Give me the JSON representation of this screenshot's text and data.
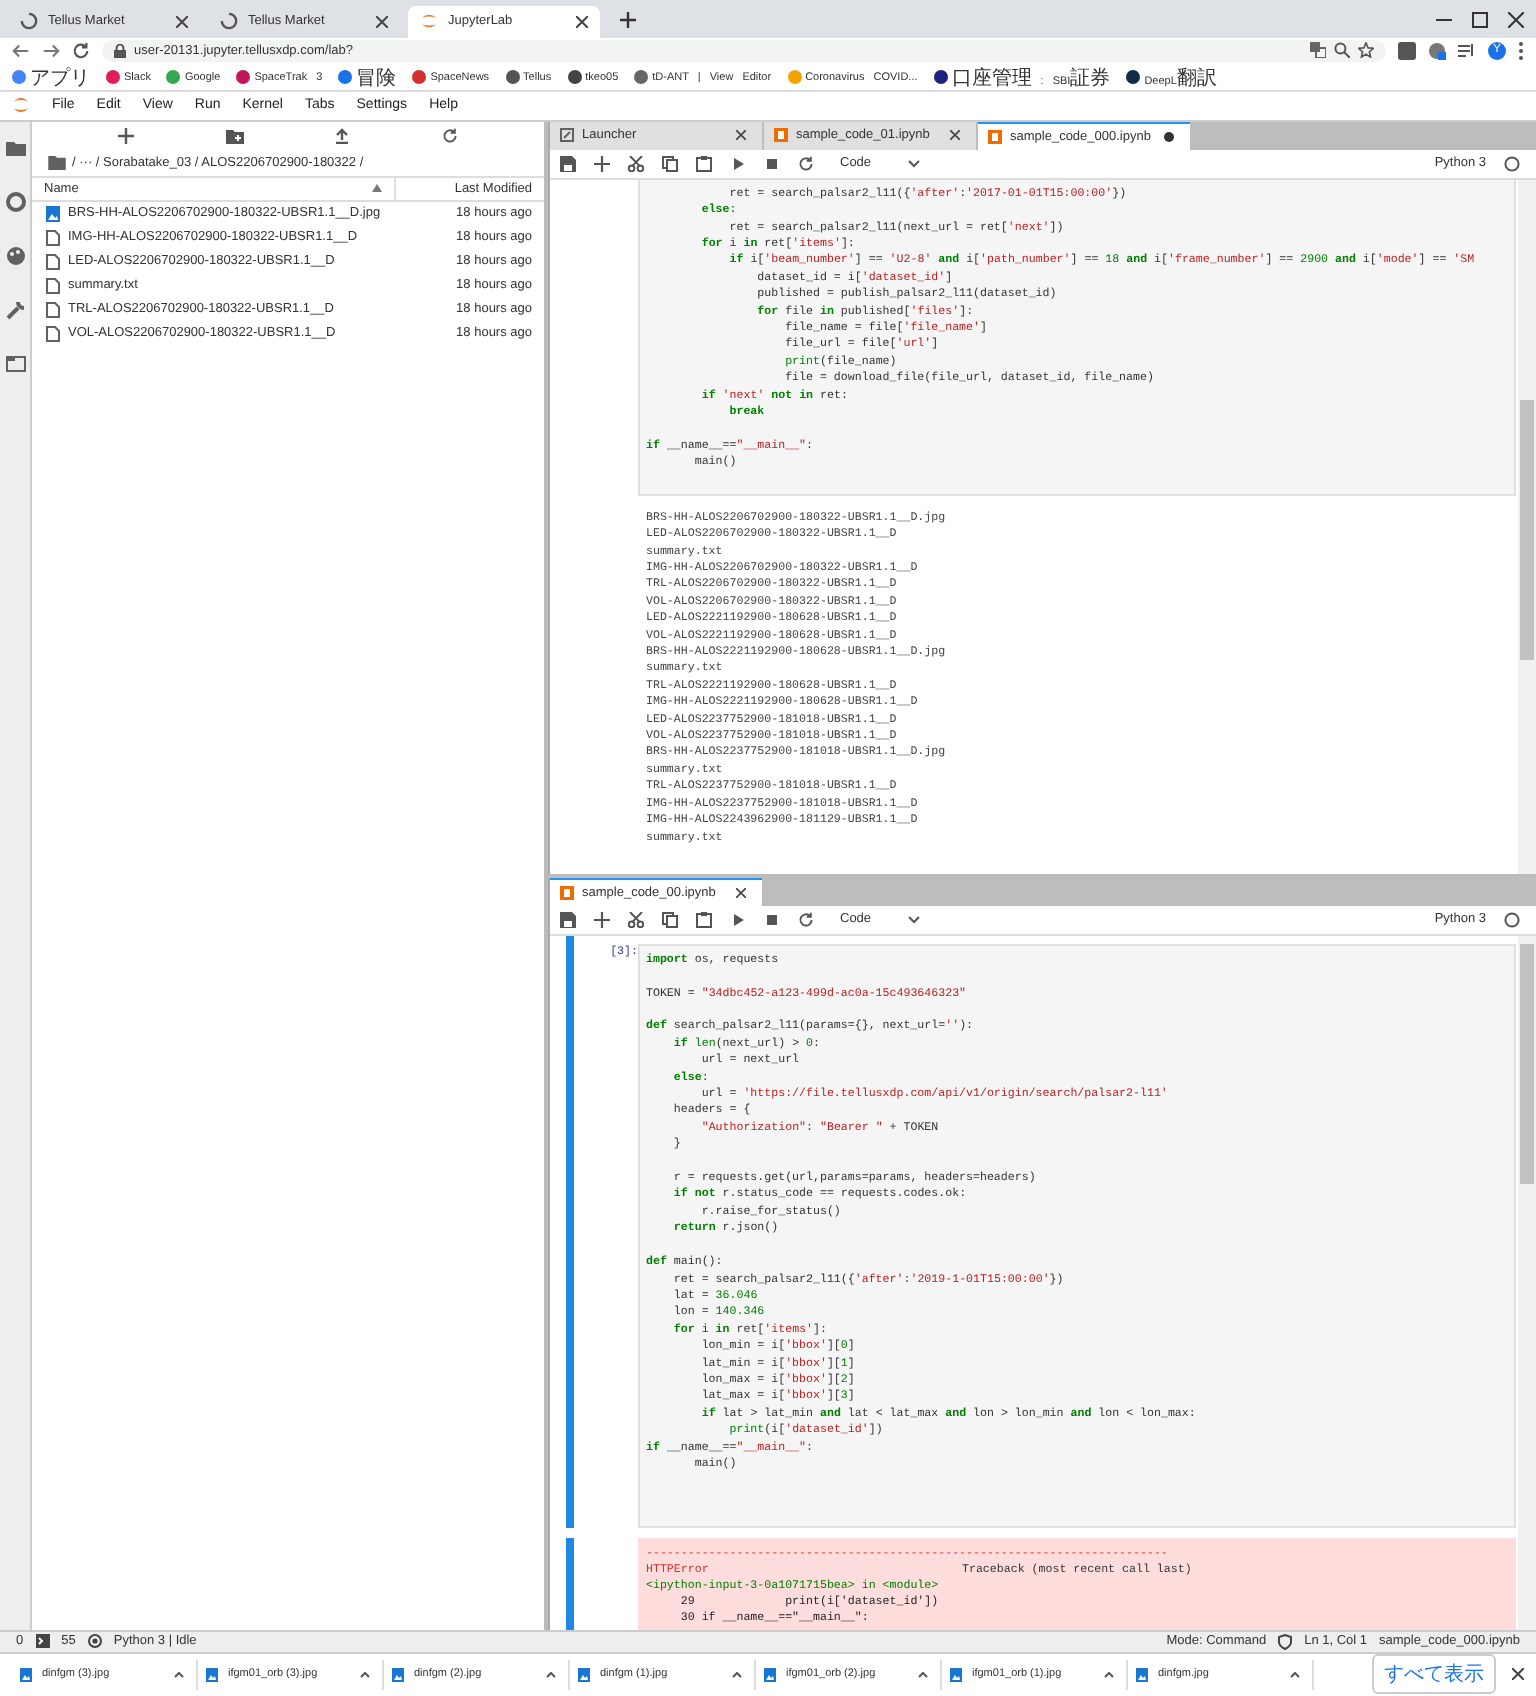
{
  "browser": {
    "tabs": [
      {
        "title": "Tellus Market",
        "kind": "loading",
        "selected": false
      },
      {
        "title": "Tellus Market",
        "kind": "loading",
        "selected": false
      },
      {
        "title": "JupyterLab",
        "kind": "jupyter",
        "selected": true
      }
    ],
    "url": "user-20131.jupyter.tellusxdp.com/lab?",
    "avatar_letter": "Y",
    "bookmarks": [
      {
        "label": "アプリ",
        "color": "#4285f4"
      },
      {
        "label": "Slack",
        "color": "#e01e5a"
      },
      {
        "label": "Google",
        "color": "#34a853"
      },
      {
        "label": "SpaceTrak 3",
        "color": "#c2185b"
      },
      {
        "label": "冒険",
        "color": "#1a73e8"
      },
      {
        "label": "SpaceNews",
        "color": "#d32f2f"
      },
      {
        "label": "Tellus",
        "color": "#555555"
      },
      {
        "label": "tkeo05",
        "color": "#444444"
      },
      {
        "label": "tD-ANT | View Editor",
        "color": "#666666"
      },
      {
        "label": "Coronavirus COVID...",
        "color": "#f4a300"
      },
      {
        "label": "口座管理 : SBI証券",
        "color": "#1a237e"
      },
      {
        "label": "DeepL翻訳",
        "color": "#0f2b46"
      }
    ]
  },
  "menu": [
    "File",
    "Edit",
    "View",
    "Run",
    "Kernel",
    "Tabs",
    "Settings",
    "Help"
  ],
  "file_browser": {
    "breadcrumb": "/ ··· / Sorabatake_03 / ALOS2206702900-180322 /",
    "columns": [
      "Name",
      "Last Modified"
    ],
    "files": [
      {
        "name": "BRS-HH-ALOS2206702900-180322-UBSR1.1__D.jpg",
        "modified": "18 hours ago",
        "kind": "image"
      },
      {
        "name": "IMG-HH-ALOS2206702900-180322-UBSR1.1__D",
        "modified": "18 hours ago",
        "kind": "file"
      },
      {
        "name": "LED-ALOS2206702900-180322-UBSR1.1__D",
        "modified": "18 hours ago",
        "kind": "file"
      },
      {
        "name": "summary.txt",
        "modified": "18 hours ago",
        "kind": "file"
      },
      {
        "name": "TRL-ALOS2206702900-180322-UBSR1.1__D",
        "modified": "18 hours ago",
        "kind": "file"
      },
      {
        "name": "VOL-ALOS2206702900-180322-UBSR1.1__D",
        "modified": "18 hours ago",
        "kind": "file"
      }
    ]
  },
  "panels": [
    {
      "tabs": [
        {
          "title": "Launcher",
          "kind": "launcher",
          "selected": false,
          "dirty": false
        },
        {
          "title": "sample_code_01.ipynb",
          "kind": "notebook",
          "selected": false,
          "dirty": false
        },
        {
          "title": "sample_code_000.ipynb",
          "kind": "notebook",
          "selected": true,
          "dirty": true
        }
      ],
      "cell_type": "Code",
      "kernel": "Python 3",
      "kernel_busy": false,
      "cell": {
        "active": false,
        "code": "            ret = search_palsar2_l11({'after':'2017-01-01T15:00:00'})\n        else:\n            ret = search_palsar2_l11(next_url = ret['next'])\n        for i in ret['items']:\n            if i['beam_number'] == 'U2-8' and i['path_number'] == 18 and i['frame_number'] == 2900 and i['mode'] == 'SM\n                dataset_id = i['dataset_id']\n                published = publish_palsar2_l11(dataset_id)\n                for file in published['files']:\n                    file_name = file['file_name']\n                    file_url = file['url']\n                    print(file_name)\n                    file = download_file(file_url, dataset_id, file_name)\n        if 'next' not in ret:\n            break\n\nif __name__==\"__main__\":\n       main()"
      },
      "output": "BRS-HH-ALOS2206702900-180322-UBSR1.1__D.jpg\nLED-ALOS2206702900-180322-UBSR1.1__D\nsummary.txt\nIMG-HH-ALOS2206702900-180322-UBSR1.1__D\nTRL-ALOS2206702900-180322-UBSR1.1__D\nVOL-ALOS2206702900-180322-UBSR1.1__D\nLED-ALOS2221192900-180628-UBSR1.1__D\nVOL-ALOS2221192900-180628-UBSR1.1__D\nBRS-HH-ALOS2221192900-180628-UBSR1.1__D.jpg\nsummary.txt\nTRL-ALOS2221192900-180628-UBSR1.1__D\nIMG-HH-ALOS2221192900-180628-UBSR1.1__D\nLED-ALOS2237752900-181018-UBSR1.1__D\nVOL-ALOS2237752900-181018-UBSR1.1__D\nBRS-HH-ALOS2237752900-181018-UBSR1.1__D.jpg\nsummary.txt\nTRL-ALOS2237752900-181018-UBSR1.1__D\nIMG-HH-ALOS2237752900-181018-UBSR1.1__D\nIMG-HH-ALOS2243962900-181129-UBSR1.1__D\nsummary.txt"
    },
    {
      "tabs": [
        {
          "title": "sample_code_00.ipynb",
          "kind": "notebook",
          "selected": true,
          "dirty": false
        }
      ],
      "cell_type": "Code",
      "kernel": "Python 3",
      "kernel_busy": false,
      "cell": {
        "prompt": "[3]:",
        "active": true,
        "code": "import os, requests\n\nTOKEN = \"34dbc452-a123-499d-ac0a-15c493646323\"\n\ndef search_palsar2_l11(params={}, next_url=''):\n    if len(next_url) > 0:\n        url = next_url\n    else:\n        url = 'https://file.tellusxdp.com/api/v1/origin/search/palsar2-l11'\n    headers = {\n        \"Authorization\": \"Bearer \" + TOKEN\n    }\n\n    r = requests.get(url,params=params, headers=headers)\n    if not r.status_code == requests.codes.ok:\n        r.raise_for_status()\n    return r.json()\n\ndef main():\n    ret = search_palsar2_l11({'after':'2019-1-01T15:00:00'})\n    lat = 36.046\n    lon = 140.346\n    for i in ret['items']:\n        lon_min = i['bbox'][0]\n        lat_min = i['bbox'][1]\n        lon_max = i['bbox'][2]\n        lat_max = i['bbox'][3]\n        if lat > lat_min and lat < lat_max and lon > lon_min and lon < lon_max:\n            print(i['dataset_id'])\nif __name__==\"__main__\":\n       main()"
      },
      "error": {
        "rule": "---------------------------------------------------------------------------",
        "name": "HTTPError",
        "traceback": "Traceback (most recent call last)",
        "location": "<ipython-input-3-0a1071715bea> in <module>",
        "lines": [
          "     29             print(i['dataset_id'])",
          "     30 if __name__==\"__main__\":"
        ]
      }
    }
  ],
  "status_bar": {
    "count": "0",
    "terminals": "55",
    "kernel": "Python 3 | Idle",
    "mode": "Mode: Command",
    "position": "Ln 1, Col 1",
    "file": "sample_code_000.ipynb"
  },
  "downloads": {
    "items": [
      "dinfgm (3).jpg",
      "ifgm01_orb (3).jpg",
      "dinfgm (2).jpg",
      "dinfgm (1).jpg",
      "ifgm01_orb (2).jpg",
      "ifgm01_orb (1).jpg",
      "dinfgm.jpg"
    ],
    "show_all": "すべて表示"
  }
}
